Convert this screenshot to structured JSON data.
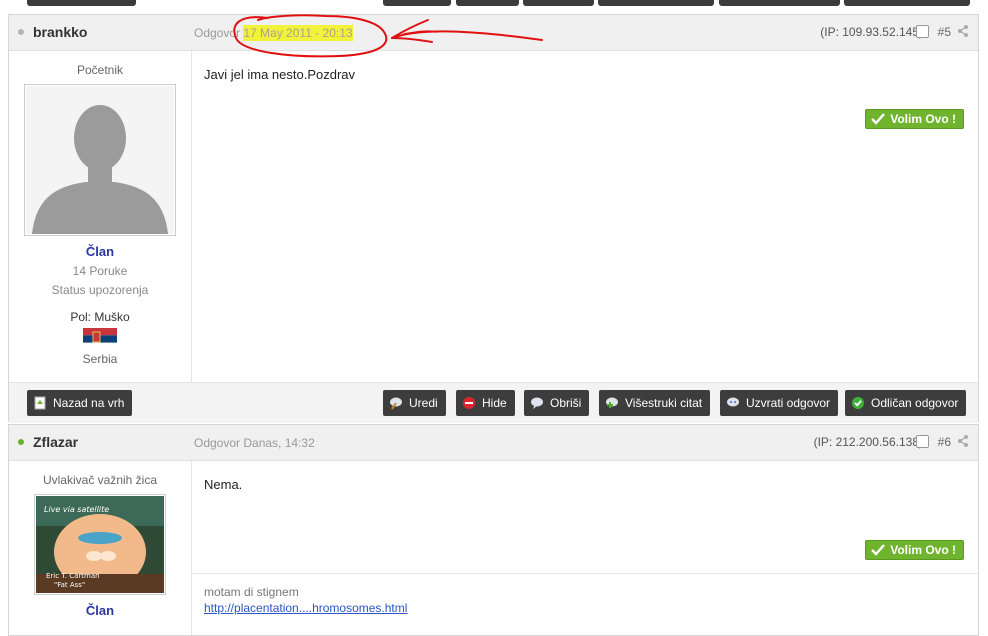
{
  "post5": {
    "author": "brankko",
    "date_prefix": "Odgovor",
    "date": "17 May 2011 - 20:13",
    "ip": "(IP: 109.93.52.145)",
    "number": "#5",
    "rank": "Početnik",
    "member_group": "Član",
    "post_count": "14 Poruke",
    "warning_status": "Status upozorenja",
    "gender": "Pol: Muško",
    "country": "Serbia",
    "content": "Javi jel ima nesto.Pozdrav",
    "like_label": "Volim Ovo !"
  },
  "footer": {
    "back_to_top": "Nazad na vrh",
    "edit": "Uredi",
    "hide": "Hide",
    "delete": "Obriši",
    "multiquote": "Višestruki citat",
    "reply": "Uzvrati odgovor",
    "best_answer": "Odličan odgovor"
  },
  "post6": {
    "author": "Zflazar",
    "date_line": "Odgovor Danas, 14:32",
    "ip": "(IP: 212.200.56.138)",
    "number": "#6",
    "rank": "Uvlakivač važnih žica",
    "member_group": "Član",
    "content": "Nema.",
    "like_label": "Volim Ovo !",
    "signature_text": "motam di stignem",
    "signature_link": "http://placentation....hromosomes.html",
    "avatar_caption_1": "Live via satellite",
    "avatar_caption_2": "Eric T. Cartman",
    "avatar_caption_3": "\"Fat Ass\""
  },
  "colors": {
    "online_dot": "#5cb52f",
    "offline_dot": "#b5b5b5",
    "like_green": "#6fb32e",
    "highlight": "#f3f23a",
    "annotation_red": "#e01010",
    "member_blue": "#2a34a3"
  }
}
